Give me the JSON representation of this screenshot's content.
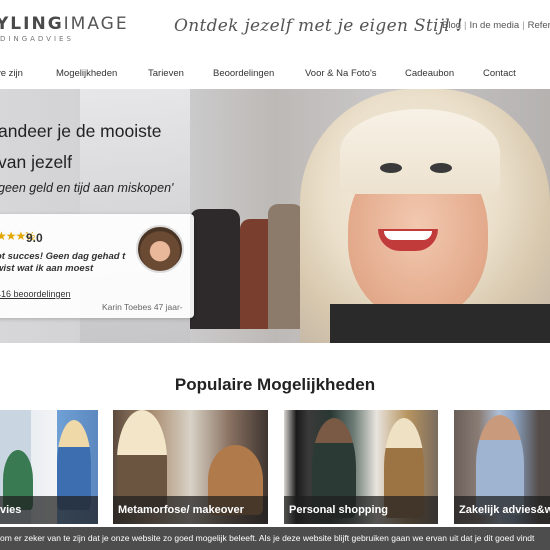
{
  "header": {
    "logo_bold": "YLING",
    "logo_light": "IMAGE",
    "logo_sub": "DINGADVIES",
    "tagline": "Ontdek jezelf met je eigen Stijl !",
    "toplinks": [
      "Blog",
      "In de media",
      "Referen"
    ]
  },
  "nav": {
    "items": [
      "ve zijn",
      "Mogelijkheden",
      "Tarieven",
      "Beoordelingen",
      "Voor & Na Foto's",
      "Cadeaubon",
      "Contact"
    ]
  },
  "hero": {
    "title_line1": "andeer je de mooiste",
    "title_line2": "van jezelf",
    "subtitle": "geen geld en tijd aan miskopen'",
    "review": {
      "stars": "★★★½",
      "score": "9.0",
      "text": "ot succes! Geen dag gehad t wist wat ik aan moest",
      "count": "416 beoordelingen",
      "author": "Karin Toebes 47 jaar-"
    }
  },
  "section": {
    "title": "Populaire Mogelijkheden",
    "cards": [
      {
        "label": "vies"
      },
      {
        "label": "Metamorfose/ makeover"
      },
      {
        "label": "Personal shopping"
      },
      {
        "label": "Zakelijk advies&w"
      }
    ]
  },
  "cookie": {
    "text": "om er zeker van te zijn dat je onze website zo goed mogelijk beleeft. Als je deze website blijft gebruiken gaan we ervan uit dat je dit goed vindt"
  }
}
